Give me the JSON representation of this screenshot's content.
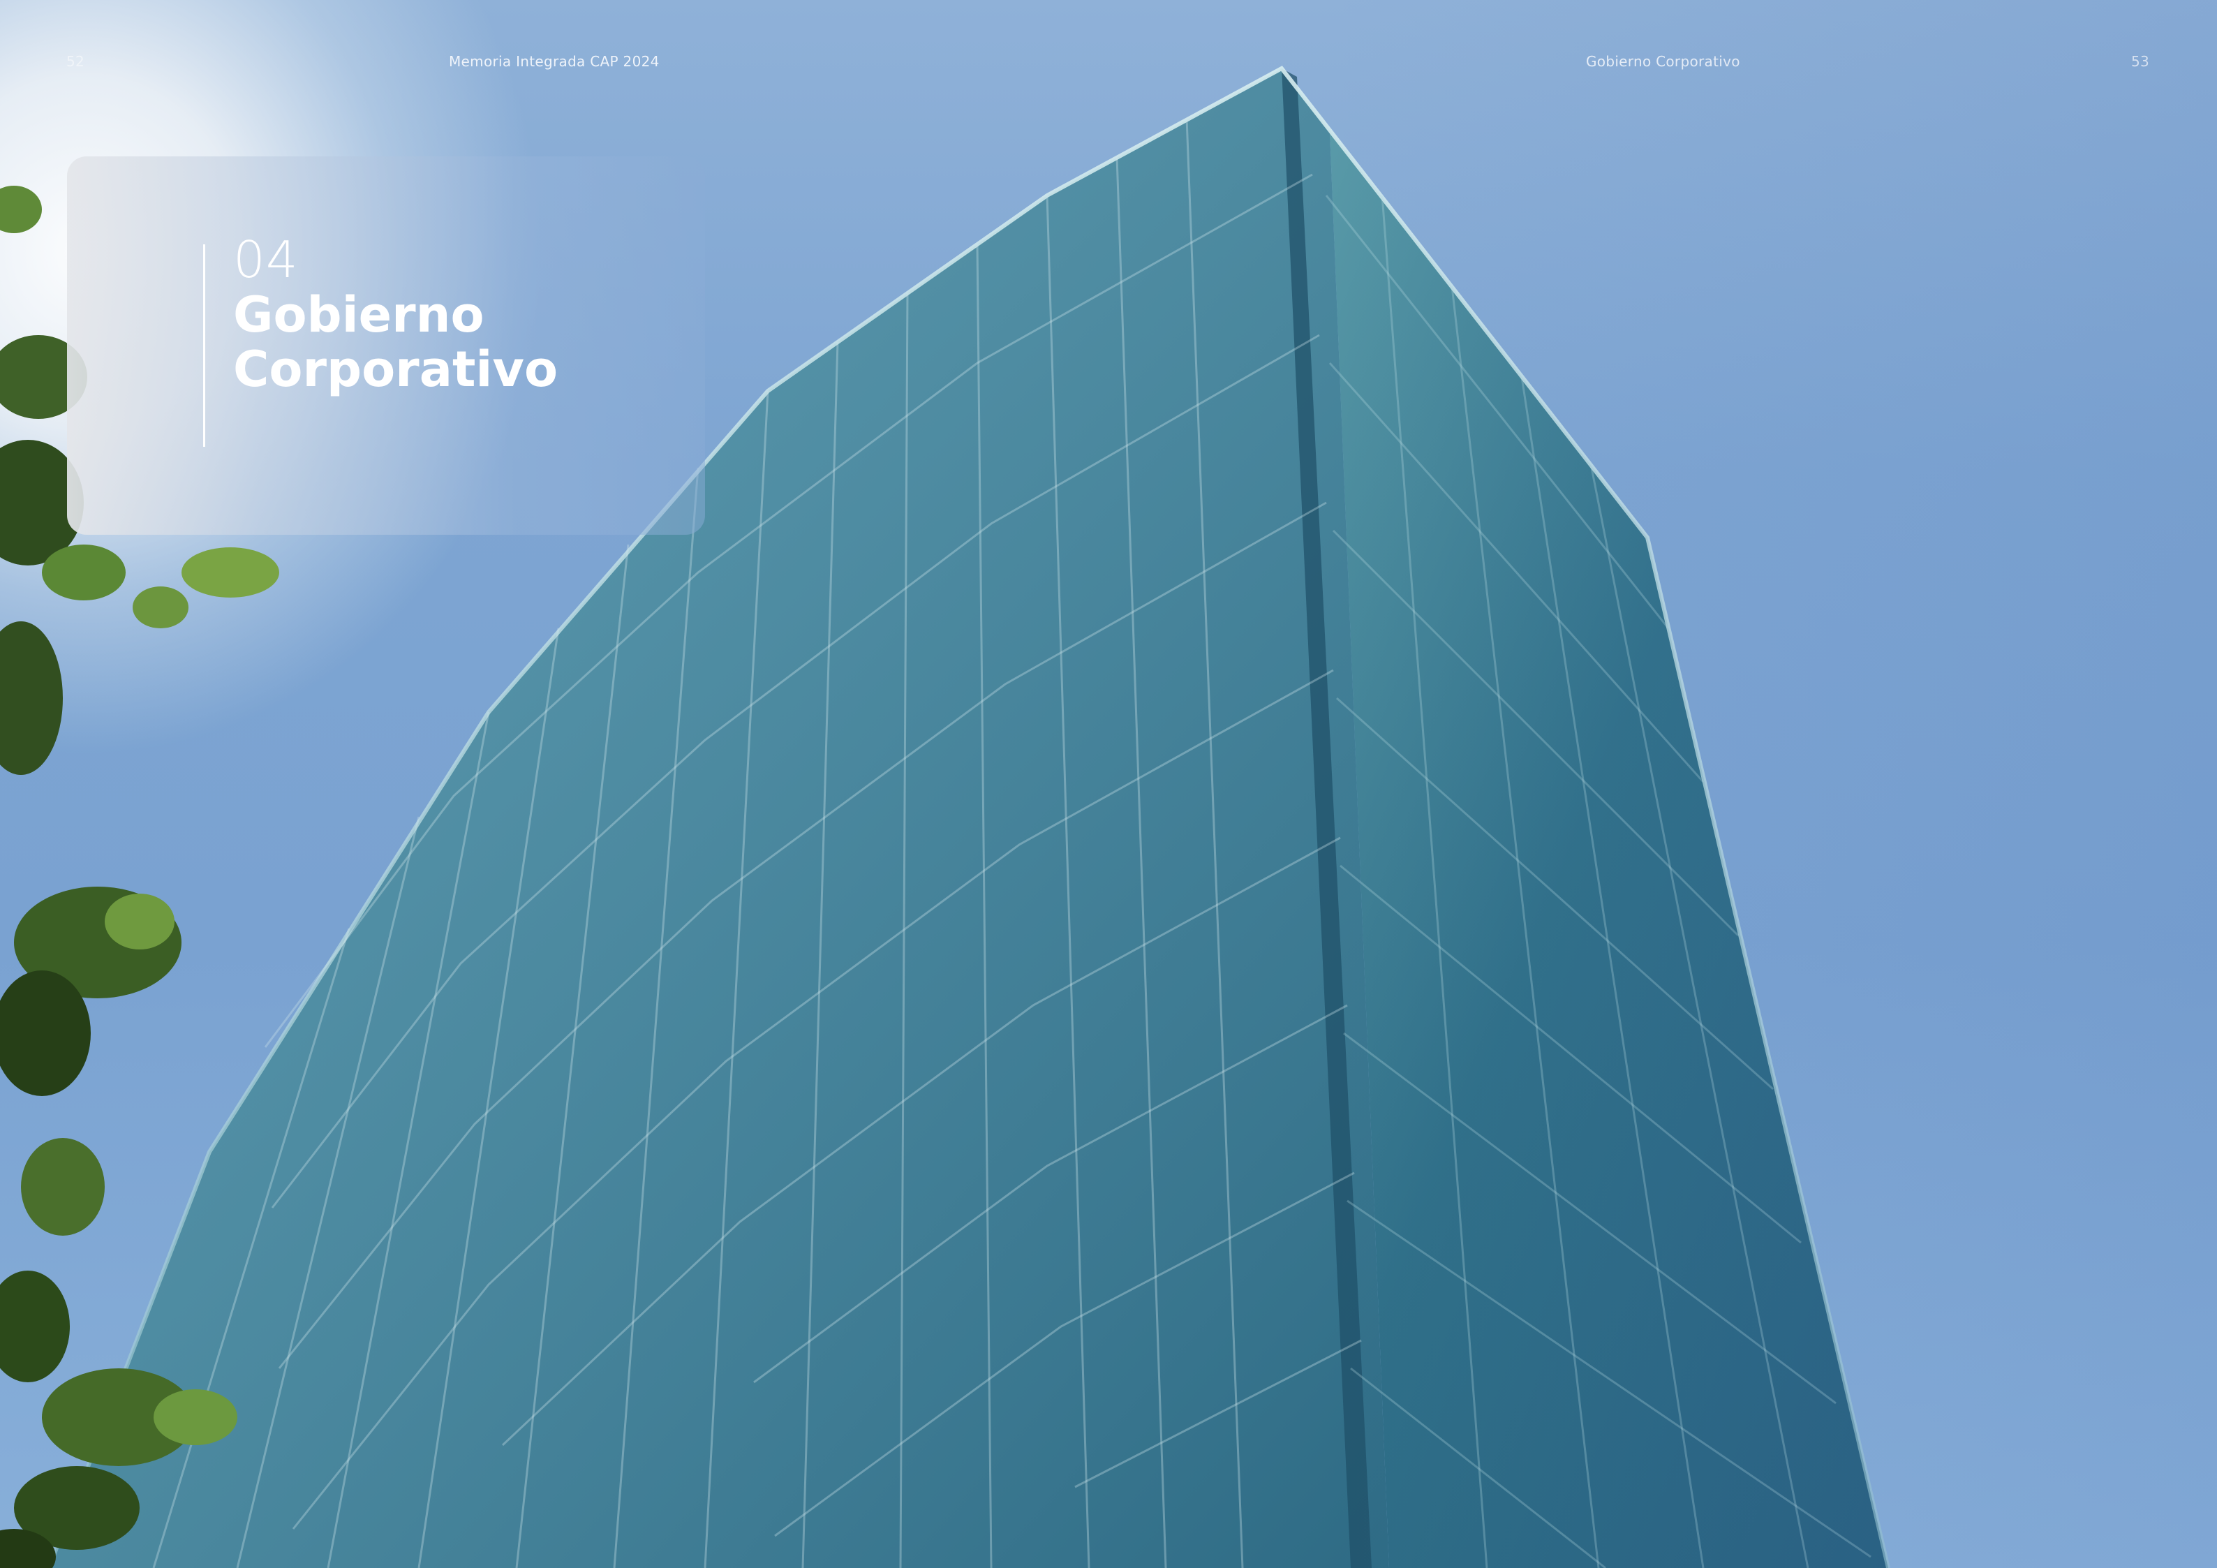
{
  "left_page": {
    "page_number": "52",
    "running_title": "Memoria Integrada  CAP 2024"
  },
  "right_page": {
    "page_number": "53",
    "running_title": "Gobierno Corporativo"
  },
  "chapter": {
    "number": "04",
    "title": "Gobierno Corporativo"
  },
  "image": {
    "subject": "glass-tower-photo",
    "foliage": "tree-foliage"
  },
  "colors": {
    "sky": "#7aa2d1",
    "glass_front": "#3f7f94",
    "glass_side": "#2f6a86",
    "title_text": "#ffffff"
  }
}
